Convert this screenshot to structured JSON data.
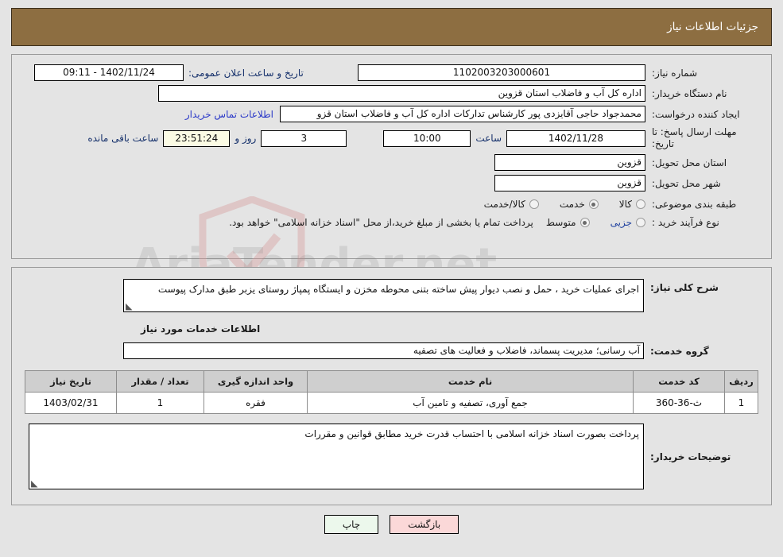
{
  "header": {
    "title": "جزئیات اطلاعات نیاز"
  },
  "form": {
    "need_number": {
      "label": "شماره نیاز:",
      "value": "1102003203000601"
    },
    "public_announce": {
      "label": "تاریخ و ساعت اعلان عمومی:",
      "value": "1402/11/24 - 09:11"
    },
    "buyer_org": {
      "label": "نام دستگاه خریدار:",
      "value": "اداره کل آب و فاضلاب استان قزوین"
    },
    "empty_field": {
      "value": ""
    },
    "requester": {
      "label": "ایجاد کننده درخواست:",
      "value": "محمدجواد حاجی آقایزدی پور کارشناس تدارکات اداره کل آب و فاضلاب استان قزو",
      "contact_link": "اطلاعات تماس خریدار"
    },
    "deadline": {
      "label": "مهلت ارسال پاسخ: تا تاریخ:",
      "label_line1": "مهلت ارسال پاسخ: تا",
      "label_line2": "تاریخ:",
      "date": "1402/11/28",
      "time_label": "ساعت",
      "time": "10:00",
      "days": "3",
      "days_label": "روز و",
      "countdown": "23:51:24",
      "countdown_label": "ساعت باقی مانده"
    },
    "delivery_province": {
      "label": "استان محل تحویل:",
      "value": "قزوین"
    },
    "delivery_city": {
      "label": "شهر محل تحویل:",
      "value": "قزوین"
    },
    "category": {
      "label": "طبقه بندی موضوعی:",
      "options": [
        {
          "label": "کالا",
          "selected": false
        },
        {
          "label": "خدمت",
          "selected": true
        },
        {
          "label": "کالا/خدمت",
          "selected": false
        }
      ]
    },
    "purchase_type": {
      "label": "نوع فرآیند خرید :",
      "options": [
        {
          "label": "جزیی",
          "selected": false
        },
        {
          "label": "متوسط",
          "selected": true
        }
      ],
      "note": "پرداخت تمام یا بخشی از مبلغ خرید،از محل \"اسناد خزانه اسلامی\" خواهد بود."
    }
  },
  "details": {
    "general_desc": {
      "label": "شرح کلی نیاز:",
      "value": "اجرای عملیات خرید ، حمل و نصب دیوار پیش ساخته بتنی محوطه مخزن و ایستگاه پمپاژ روستای یزبر طبق مدارک پیوست"
    },
    "services_section_title": "اطلاعات خدمات مورد نیاز",
    "service_group": {
      "label": "گروه خدمت:",
      "value": "آب رسانی؛ مدیریت پسماند، فاضلاب و فعالیت های تصفیه"
    },
    "table": {
      "columns": [
        "ردیف",
        "کد خدمت",
        "نام خدمت",
        "واحد اندازه گیری",
        "تعداد / مقدار",
        "تاریخ نیاز"
      ],
      "rows": [
        {
          "row": "1",
          "service_code": "ث-36-360",
          "service_name": "جمع آوری، تصفیه و تامین آب",
          "unit": "فقره",
          "quantity": "1",
          "need_date": "1403/02/31"
        }
      ]
    },
    "buyer_notes": {
      "label": "توضیحات خریدار:",
      "value": "پرداخت بصورت اسناد خزانه اسلامی با احتساب قدرت خرید مطابق قوانین و مقررات"
    }
  },
  "footer": {
    "print_label": "چاپ",
    "back_label": "بازگشت"
  },
  "watermark": {
    "text": "AriaTender.net"
  },
  "colors": {
    "header_brown": "#8d6e41",
    "page_bg": "#e4e4e4",
    "link_blue": "#2a38c8",
    "countdown_bg": "#fbfbe4",
    "print_btn": "#ecf8ec",
    "back_btn": "#fbd8d8",
    "table_header": "#cfcfcf"
  }
}
